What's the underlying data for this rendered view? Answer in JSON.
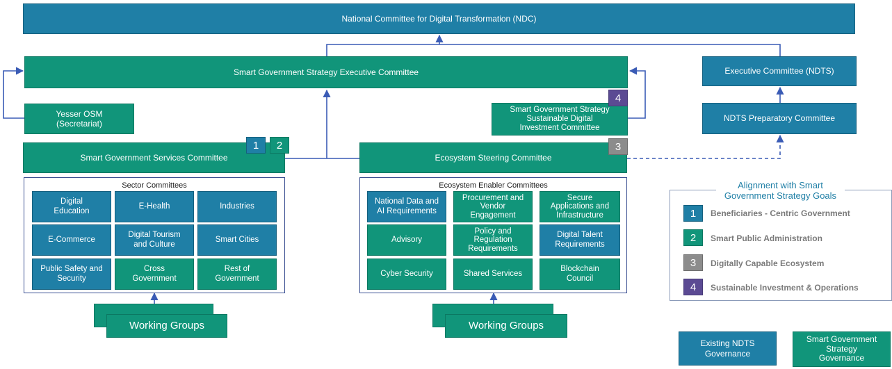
{
  "ndc": "National Committee for Digital Transformation (NDC)",
  "sg_exec": "Smart Government Strategy Executive Committee",
  "ndts_exec": "Executive Committee (NDTS)",
  "ndts_prep": "NDTS Preparatory Committee",
  "yesser": "Yesser OSM\n(Secretariat)",
  "investment": "Smart Government Strategy\nSustainable Digital\nInvestment Committee",
  "services": "Smart Government Services Committee",
  "ecosystem": "Ecosystem Steering Committee",
  "sector": {
    "title": "Sector Committees",
    "cells": [
      "Digital\nEducation",
      "E-Health",
      "Industries",
      "E-Commerce",
      "Digital Tourism\nand Culture",
      "Smart Cities",
      "Public Safety and\nSecurity",
      "Cross\nGovernment",
      "Rest of\nGovernment"
    ]
  },
  "enabler": {
    "title": "Ecosystem Enabler Committees",
    "cells": [
      "National Data and\nAI Requirements",
      "Procurement and\nVendor\nEngagement",
      "Secure\nApplications and\nInfrastructure",
      "Advisory",
      "Policy and\nRegulation\nRequirements",
      "Digital Talent\nRequirements",
      "Cyber Security",
      "Shared Services",
      "Blockchain\nCouncil"
    ]
  },
  "working_groups": "Working Groups",
  "badges": [
    "1",
    "2",
    "3",
    "4"
  ],
  "alignment": {
    "title": "Alignment with Smart\nGovernment Strategy Goals",
    "goals": [
      {
        "num": "1",
        "label": "Beneficiaries - Centric Government"
      },
      {
        "num": "2",
        "label": "Smart Public Administration"
      },
      {
        "num": "3",
        "label": "Digitally Capable Ecosystem"
      },
      {
        "num": "4",
        "label": "Sustainable Investment & Operations"
      }
    ]
  },
  "legend": {
    "existing": "Existing NDTS\nGovernance",
    "smart": "Smart Government\nStrategy\nGovernance"
  },
  "colors": {
    "blue": "#1f7fa6",
    "green": "#11957a",
    "grey": "#8c8c8c",
    "purple": "#5b4a93",
    "line": "#3a5bb5"
  }
}
